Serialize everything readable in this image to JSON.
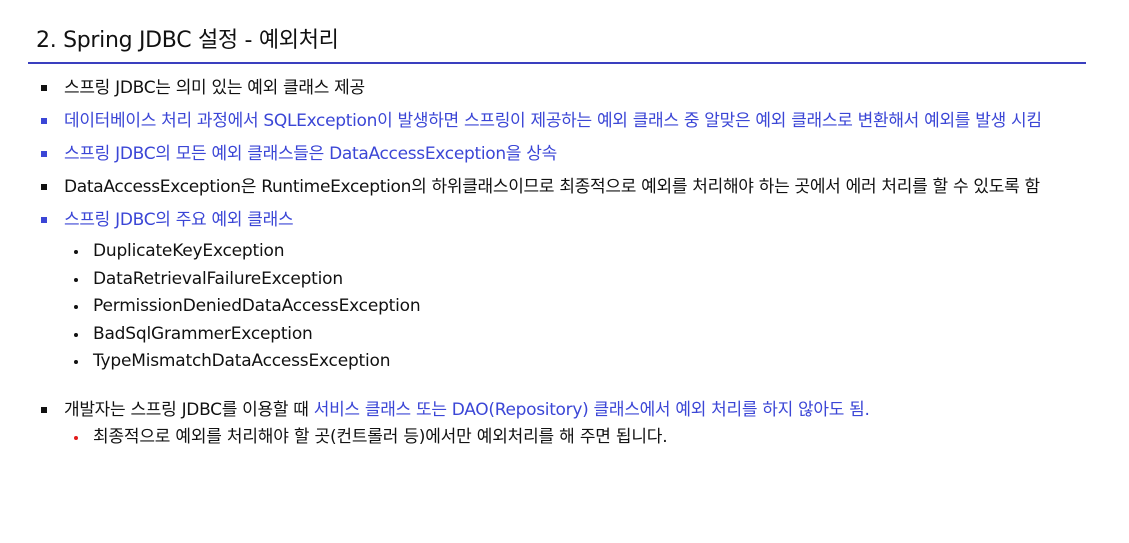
{
  "title": "2. Spring JDBC 설정 - 예외처리",
  "bullets": [
    {
      "text": "스프링 JDBC는 의미 있는 예외 클래스 제공"
    },
    {
      "highlight": "데이터베이스 처리 과정에서 SQLException이 발생하면",
      "rest": " 스프링이 제공하는 예외 클래스 중 알맞은 예외 클래스로 변환해서 예외를 발생 시킴"
    },
    {
      "text": "스프링 JDBC의 모든 예외 클래스들은 DataAccessException을 상속"
    },
    {
      "text": "DataAccessException은 RuntimeException의 하위클래스이므로 최종적으로 예외를 처리해야 하는 곳에서 에러 처리를 할 수 있도록 함"
    },
    {
      "text": "스프링 JDBC의 주요 예외 클래스",
      "items": [
        "DuplicateKeyException",
        "DataRetrievalFailureException",
        "PermissionDeniedDataAccessException",
        "BadSqlGrammerException",
        "TypeMismatchDataAccessException"
      ]
    },
    {
      "prefix": "개발자는 스프링 JDBC를 이용할 때 ",
      "highlight": "서비스 클래스 또는 DAO(Repository) 클래스에서 예외 처리를 하지 않아도 됨.",
      "sub": "최종적으로 예외를 처리해야 할 곳(컨트롤러 등)에서만 예외처리를 해 주면 됩니다."
    }
  ]
}
